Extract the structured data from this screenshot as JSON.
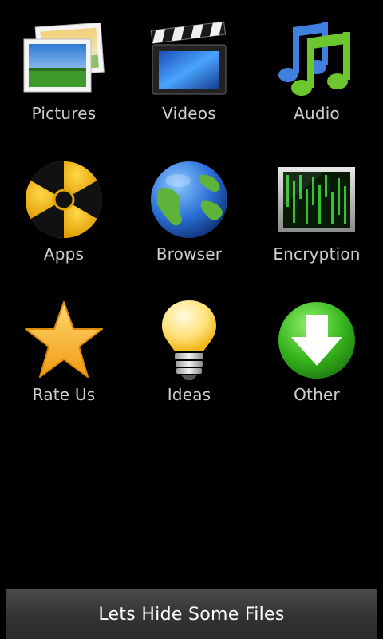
{
  "tiles": [
    {
      "label": "Pictures",
      "icon": "pictures-icon"
    },
    {
      "label": "Videos",
      "icon": "video-clapper-icon"
    },
    {
      "label": "Audio",
      "icon": "music-notes-icon"
    },
    {
      "label": "Apps",
      "icon": "radiation-icon"
    },
    {
      "label": "Browser",
      "icon": "globe-icon"
    },
    {
      "label": "Encryption",
      "icon": "matrix-code-icon"
    },
    {
      "label": "Rate Us",
      "icon": "star-icon"
    },
    {
      "label": "Ideas",
      "icon": "light-bulb-icon"
    },
    {
      "label": "Other",
      "icon": "download-arrow-icon"
    }
  ],
  "bottom_button": {
    "label": "Lets Hide Some Files"
  },
  "colors": {
    "background": "#000000",
    "label_text": "#cfcfcf",
    "bar_text": "#ffffff",
    "star": "#f7b52b",
    "radiation_yellow": "#f5b400",
    "globe_ocean": "#2a6fd6",
    "globe_land": "#5fb23a",
    "other_green": "#37b51d"
  }
}
